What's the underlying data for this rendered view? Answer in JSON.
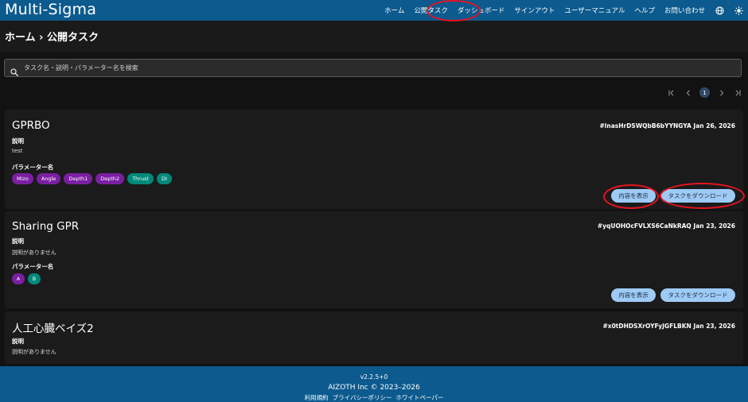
{
  "app": {
    "logo": "Multi-Sigma"
  },
  "nav": {
    "items": [
      "ホーム",
      "公開タスク",
      "ダッシュボード",
      "サインアウト",
      "ユーザーマニュアル",
      "ヘルプ",
      "お問い合わせ"
    ],
    "icons": [
      "globe-icon",
      "sun-icon"
    ]
  },
  "breadcrumb": "ホーム › 公開タスク",
  "search": {
    "placeholder": "タスク名・説明・パラメーター名を検索"
  },
  "pagination": {
    "current_page": "1"
  },
  "labels": {
    "description": "説明",
    "params": "パラメーター名",
    "view": "内容を表示",
    "download": "タスクをダウンロード"
  },
  "tasks": [
    {
      "title": "GPRBO",
      "meta": "#lnasHrDSWQbB6bYYNGYA  Jan 26, 2026",
      "description": "test",
      "params": [
        {
          "name": "Mizo",
          "color": "#7b1fa2"
        },
        {
          "name": "Angle",
          "color": "#7b1fa2"
        },
        {
          "name": "Depth1",
          "color": "#7b1fa2"
        },
        {
          "name": "Depth2",
          "color": "#7b1fa2"
        },
        {
          "name": "Thrust",
          "color": "#00897b"
        },
        {
          "name": "DI",
          "color": "#00897b"
        }
      ]
    },
    {
      "title": "Sharing GPR",
      "meta": "#yqUOHOcFVLXS6CaNkRAQ  Jan 23, 2026",
      "description": "説明がありません",
      "params": [
        {
          "name": "A",
          "color": "#7b1fa2"
        },
        {
          "name": "B",
          "color": "#00897b"
        }
      ]
    },
    {
      "title": "人工心臓ベイズ2",
      "meta": "#x0tDHDSXrOYFyJGFLBKN  Jan 23, 2026",
      "description": "説明がありません",
      "params": []
    }
  ],
  "footer": {
    "version": "v2.2.5+0",
    "copyright": "AIZOTH Inc © 2023–2026",
    "links": [
      "利用規約",
      "プライバシーポリシー",
      "ホワイトペーパー"
    ]
  },
  "colors": {
    "header_bg": "#0c5a8e",
    "page_bg": "#121212",
    "card_bg": "#1b1b1b",
    "button_bg": "#9ecaf6",
    "annotation_red": "#e5141f"
  }
}
